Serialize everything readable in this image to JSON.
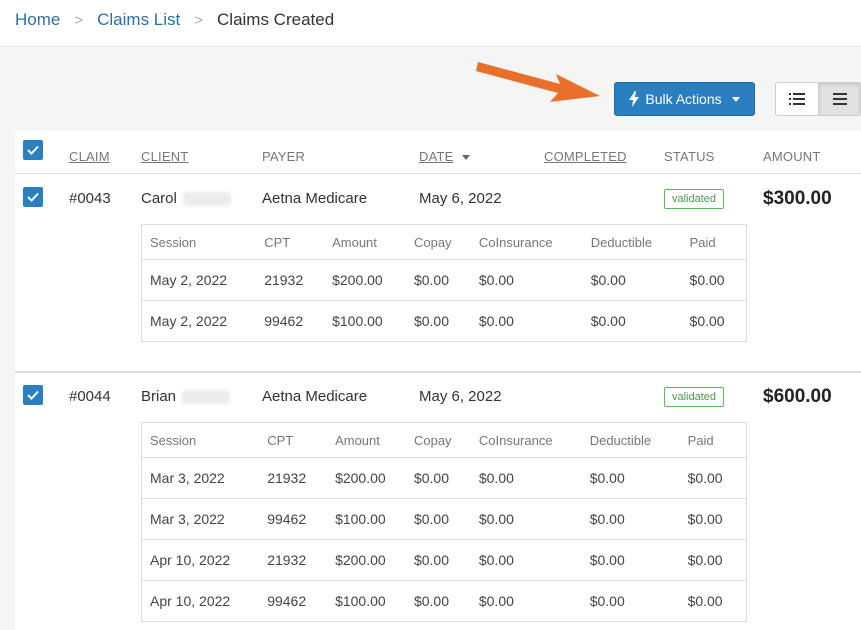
{
  "breadcrumb": {
    "home": "Home",
    "claims_list": "Claims List",
    "current": "Claims Created",
    "separator": ">"
  },
  "toolbar": {
    "bulk_actions_label": "Bulk Actions",
    "bulk_actions_color": "#2a7fc1",
    "view_modes": [
      "list-view-icon",
      "compact-view-icon"
    ],
    "active_view": "compact-view-icon"
  },
  "table": {
    "headers": {
      "claim": "CLAIM",
      "client": "CLIENT",
      "payer": "PAYER",
      "date": "DATE",
      "completed": "COMPLETED",
      "status": "STATUS",
      "amount": "AMOUNT"
    },
    "sub_headers": {
      "session": "Session",
      "cpt": "CPT",
      "amount": "Amount",
      "copay": "Copay",
      "coinsurance": "CoInsurance",
      "deductible": "Deductible",
      "paid": "Paid"
    },
    "claims": [
      {
        "id": "#0043",
        "client": "Carol",
        "payer": "Aetna Medicare",
        "date": "May 6, 2022",
        "status": "validated",
        "amount": "$300.00",
        "sessions": [
          {
            "session": "May 2, 2022",
            "cpt": "21932",
            "amount": "$200.00",
            "copay": "$0.00",
            "coinsurance": "$0.00",
            "deductible": "$0.00",
            "paid": "$0.00"
          },
          {
            "session": "May 2, 2022",
            "cpt": "99462",
            "amount": "$100.00",
            "copay": "$0.00",
            "coinsurance": "$0.00",
            "deductible": "$0.00",
            "paid": "$0.00"
          }
        ]
      },
      {
        "id": "#0044",
        "client": "Brian",
        "payer": "Aetna Medicare",
        "date": "May 6, 2022",
        "status": "validated",
        "amount": "$600.00",
        "sessions": [
          {
            "session": "Mar 3, 2022",
            "cpt": "21932",
            "amount": "$200.00",
            "copay": "$0.00",
            "coinsurance": "$0.00",
            "deductible": "$0.00",
            "paid": "$0.00"
          },
          {
            "session": "Mar 3, 2022",
            "cpt": "99462",
            "amount": "$100.00",
            "copay": "$0.00",
            "coinsurance": "$0.00",
            "deductible": "$0.00",
            "paid": "$0.00"
          },
          {
            "session": "Apr 10, 2022",
            "cpt": "21932",
            "amount": "$200.00",
            "copay": "$0.00",
            "coinsurance": "$0.00",
            "deductible": "$0.00",
            "paid": "$0.00"
          },
          {
            "session": "Apr 10, 2022",
            "cpt": "99462",
            "amount": "$100.00",
            "copay": "$0.00",
            "coinsurance": "$0.00",
            "deductible": "$0.00",
            "paid": "$0.00"
          }
        ]
      }
    ]
  },
  "annotation": {
    "arrow_color": "#e8702a"
  }
}
